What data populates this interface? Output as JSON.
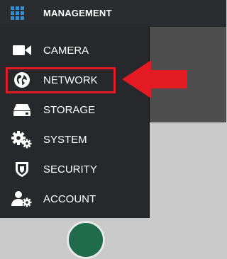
{
  "header": {
    "title": "MANAGEMENT",
    "icon": "grid-menu-icon"
  },
  "menu": {
    "items": [
      {
        "label": "CAMERA",
        "icon": "camera-icon"
      },
      {
        "label": "NETWORK",
        "icon": "network-globe-icon",
        "highlighted": true
      },
      {
        "label": "STORAGE",
        "icon": "storage-drive-icon"
      },
      {
        "label": "SYSTEM",
        "icon": "gears-icon"
      },
      {
        "label": "SECURITY",
        "icon": "shield-icon"
      },
      {
        "label": "ACCOUNT",
        "icon": "user-gear-icon"
      }
    ]
  },
  "colors": {
    "menu_bg": "#26282c",
    "accent_icon": "#2f8fd8",
    "annotation_red": "#e41b23"
  }
}
